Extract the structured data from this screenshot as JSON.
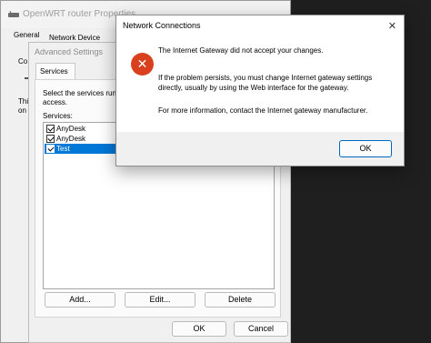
{
  "router_window": {
    "title": "OpenWRT router Properties",
    "tabs": [
      "General",
      "Network Device"
    ],
    "left_text": [
      "Co",
      "Thi",
      "on"
    ]
  },
  "advanced_window": {
    "title": "Advanced Settings",
    "tab": "Services",
    "description_line1": "Select the services run",
    "description_line2": "access.",
    "services_label": "Services:",
    "services": [
      {
        "label": "AnyDesk",
        "checked": true,
        "selected": false
      },
      {
        "label": "AnyDesk",
        "checked": true,
        "selected": false
      },
      {
        "label": "Test",
        "checked": true,
        "selected": true
      }
    ],
    "buttons": {
      "add": "Add...",
      "edit": "Edit...",
      "delete": "Delete",
      "ok": "OK",
      "cancel": "Cancel"
    }
  },
  "dialog": {
    "title": "Network Connections",
    "close_glyph": "✕",
    "icon_glyph": "✕",
    "messages": [
      "The Internet Gateway did not accept your changes.",
      "If the problem persists, you must change Internet gateway settings",
      "directly, usually by using the Web interface for the gateway.",
      "For more information, contact the Internet gateway manufacturer."
    ],
    "ok_label": "OK"
  },
  "colors": {
    "error_icon": "#d9401e",
    "selection": "#0078d7",
    "dark_background": "#1f1f1f"
  }
}
